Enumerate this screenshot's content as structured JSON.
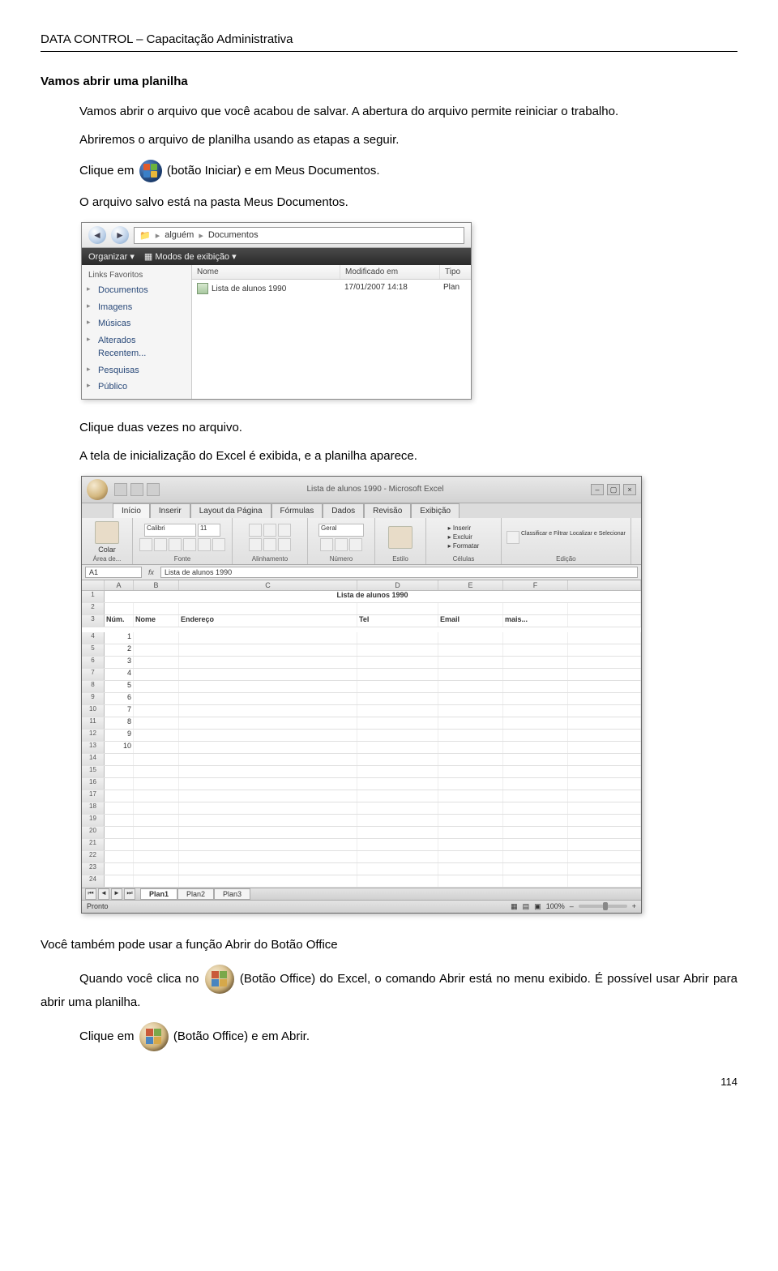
{
  "header": "DATA CONTROL – Capacitação Administrativa",
  "section_title": "Vamos abrir uma planilha",
  "para1": "Vamos abrir o arquivo que você acabou de salvar. A abertura do arquivo permite reiniciar o trabalho.",
  "para2": "Abriremos o arquivo de planilha usando as etapas a seguir.",
  "para3_pre": "Clique em ",
  "para3_post": "(botão Iniciar) e em Meus Documentos.",
  "para4": "O arquivo salvo está na pasta Meus Documentos.",
  "para5": "Clique duas vezes no arquivo.",
  "para6": "A tela de inicialização do Excel é exibida, e a planilha aparece.",
  "para7": "Você também pode usar a função Abrir do Botão Office",
  "para8_pre": "Quando você clica no ",
  "para8_post": "(Botão Office) do Excel, o comando Abrir está no menu exibido. É possível usar Abrir para abrir uma planilha.",
  "para9_pre": "Clique em ",
  "para9_post": "(Botão Office) e em Abrir.",
  "page_number": "114",
  "explorer": {
    "crumb1": "alguém",
    "crumb2": "Documentos",
    "toolbar_organize": "Organizar",
    "toolbar_views": "Modos de exibição",
    "side_title": "Links Favoritos",
    "side_items": [
      "Documentos",
      "Imagens",
      "Músicas",
      "Alterados Recentem...",
      "Pesquisas",
      "Público"
    ],
    "col_name": "Nome",
    "col_date": "Modificado em",
    "col_type": "Tipo",
    "file_name": "Lista de alunos 1990",
    "file_date": "17/01/2007 14:18",
    "file_type": "Plan"
  },
  "excel": {
    "title": "Lista de alunos 1990 - Microsoft Excel",
    "tabs": [
      "Início",
      "Inserir",
      "Layout da Página",
      "Fórmulas",
      "Dados",
      "Revisão",
      "Exibição"
    ],
    "ribbon": {
      "area": "Área de...",
      "paste": "Colar",
      "font_name": "Calibri",
      "font_size": "11",
      "font_group": "Fonte",
      "align_group": "Alinhamento",
      "number_format": "Geral",
      "number_group": "Número",
      "style_btn": "Estilo",
      "cells_insert": "Inserir",
      "cells_delete": "Excluir",
      "cells_format": "Formatar",
      "cells_group": "Células",
      "edit_sort": "Classificar e Filtrar",
      "edit_find": "Localizar e Selecionar",
      "edit_group": "Edição"
    },
    "namebox": "A1",
    "formula": "Lista de alunos 1990",
    "cols": [
      "A",
      "B",
      "C",
      "D",
      "E",
      "F"
    ],
    "row1_title": "Lista de alunos 1990",
    "row3": [
      "Núm.",
      "Nome",
      "Endereço",
      "Tel",
      "Email",
      "mais..."
    ],
    "nums": [
      "1",
      "2",
      "3",
      "4",
      "5",
      "6",
      "7",
      "8",
      "9",
      "10"
    ],
    "row_headers": [
      "1",
      "2",
      "3",
      "4",
      "5",
      "6",
      "7",
      "8",
      "9",
      "10",
      "11",
      "12",
      "13",
      "14",
      "15",
      "16",
      "17",
      "18",
      "19",
      "20",
      "21",
      "22",
      "23",
      "24"
    ],
    "sheets": [
      "Plan1",
      "Plan2",
      "Plan3"
    ],
    "status": "Pronto",
    "zoom": "100%"
  }
}
